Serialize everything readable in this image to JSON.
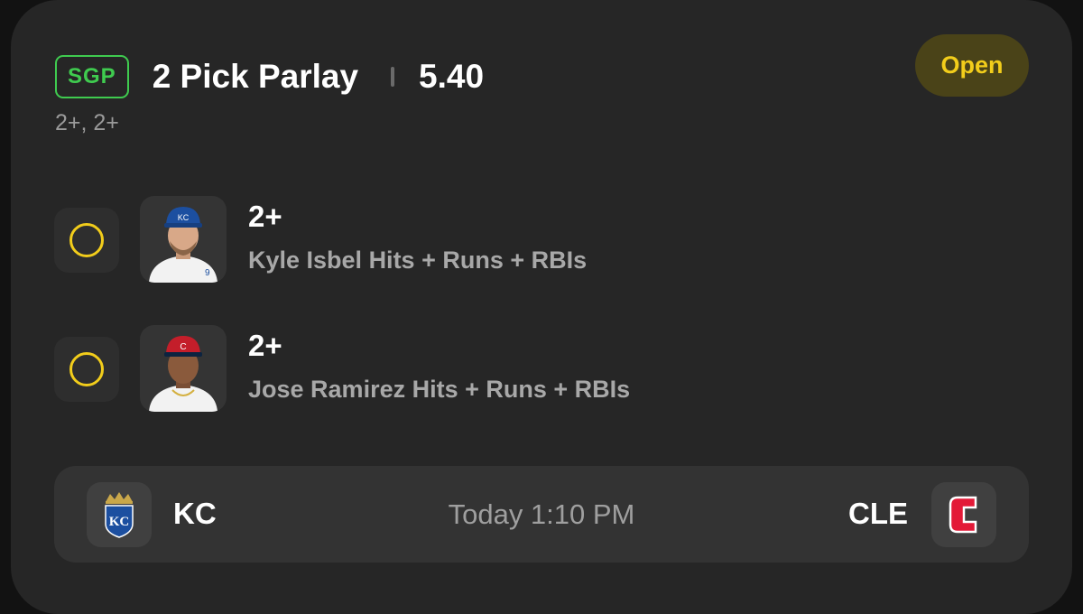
{
  "header": {
    "badge": "SGP",
    "title": "2 Pick Parlay",
    "odds": "5.40",
    "subtitle": "2+, 2+",
    "status": "Open"
  },
  "picks": [
    {
      "line": "2+",
      "description": "Kyle Isbel Hits + Runs + RBIs",
      "cap_color": "#1c4fa0",
      "jersey_color": "#f2f2f2"
    },
    {
      "line": "2+",
      "description": "Jose Ramirez Hits + Runs + RBIs",
      "cap_color": "#c41e2a",
      "jersey_color": "#f2f2f2"
    }
  ],
  "game": {
    "away_team": "KC",
    "home_team": "CLE",
    "time": "Today 1:10 PM"
  },
  "colors": {
    "accent_green": "#3fcb4f",
    "open_yellow": "#f2cd1b",
    "kc_blue": "#1c4fa0",
    "cle_red": "#e31937"
  },
  "icons": {
    "pick_status": "pending-circle-icon",
    "away_logo": "kansas-city-royals-logo",
    "home_logo": "cleveland-guardians-logo"
  }
}
